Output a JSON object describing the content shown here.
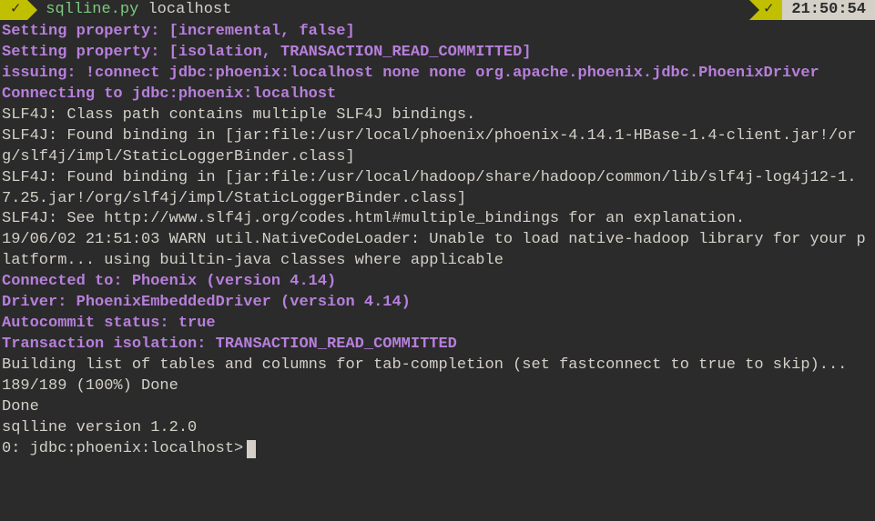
{
  "statusbar": {
    "left_check": "✓",
    "command": "sqlline.py",
    "arg": "localhost",
    "right_check": "✓",
    "clock": "21:50:54"
  },
  "lines": [
    {
      "cls": "purple",
      "text": "Setting property: [incremental, false]"
    },
    {
      "cls": "purple",
      "text": "Setting property: [isolation, TRANSACTION_READ_COMMITTED]"
    },
    {
      "cls": "purple",
      "text": "issuing: !connect jdbc:phoenix:localhost none none org.apache.phoenix.jdbc.PhoenixDriver"
    },
    {
      "cls": "purple",
      "text": "Connecting to jdbc:phoenix:localhost"
    },
    {
      "cls": "white",
      "text": "SLF4J: Class path contains multiple SLF4J bindings."
    },
    {
      "cls": "white",
      "text": "SLF4J: Found binding in [jar:file:/usr/local/phoenix/phoenix-4.14.1-HBase-1.4-client.jar!/org/slf4j/impl/StaticLoggerBinder.class]"
    },
    {
      "cls": "white",
      "text": "SLF4J: Found binding in [jar:file:/usr/local/hadoop/share/hadoop/common/lib/slf4j-log4j12-1.7.25.jar!/org/slf4j/impl/StaticLoggerBinder.class]"
    },
    {
      "cls": "white",
      "text": "SLF4J: See http://www.slf4j.org/codes.html#multiple_bindings for an explanation."
    },
    {
      "cls": "white",
      "text": "19/06/02 21:51:03 WARN util.NativeCodeLoader: Unable to load native-hadoop library for your platform... using builtin-java classes where applicable"
    },
    {
      "cls": "purple",
      "text": "Connected to: Phoenix (version 4.14)"
    },
    {
      "cls": "purple",
      "text": "Driver: PhoenixEmbeddedDriver (version 4.14)"
    },
    {
      "cls": "purple",
      "text": "Autocommit status: true"
    },
    {
      "cls": "purple",
      "text": "Transaction isolation: TRANSACTION_READ_COMMITTED"
    },
    {
      "cls": "white",
      "text": "Building list of tables and columns for tab-completion (set fastconnect to true to skip)..."
    },
    {
      "cls": "white",
      "text": "189/189 (100%) Done"
    },
    {
      "cls": "white",
      "text": "Done"
    },
    {
      "cls": "white",
      "text": "sqlline version 1.2.0"
    }
  ],
  "prompt": "0: jdbc:phoenix:localhost>"
}
